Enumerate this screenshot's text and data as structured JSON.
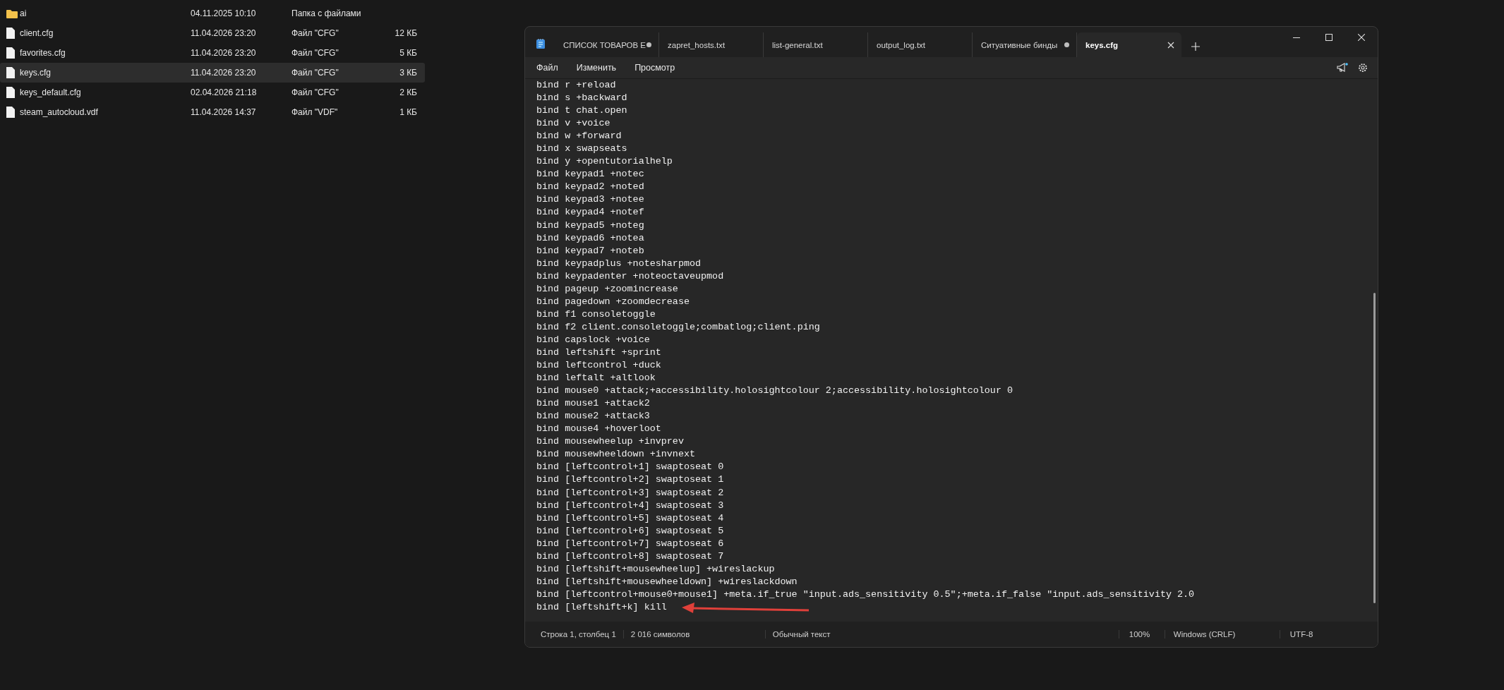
{
  "explorer": {
    "files": [
      {
        "kind": "folder",
        "name": "ai",
        "date": "04.11.2025 10:10",
        "type": "Папка с файлами",
        "selected": false
      },
      {
        "kind": "file",
        "name": "client.cfg",
        "date": "11.04.2026 23:20",
        "type": "Файл \"CFG\"",
        "size": "12 КБ",
        "selected": false
      },
      {
        "kind": "file",
        "name": "favorites.cfg",
        "date": "11.04.2026 23:20",
        "type": "Файл \"CFG\"",
        "size": "5 КБ",
        "selected": false
      },
      {
        "kind": "file",
        "name": "keys.cfg",
        "date": "11.04.2026 23:20",
        "type": "Файл \"CFG\"",
        "size": "3 КБ",
        "selected": true
      },
      {
        "kind": "file",
        "name": "keys_default.cfg",
        "date": "02.04.2026 21:18",
        "type": "Файл \"CFG\"",
        "size": "2 КБ",
        "selected": false
      },
      {
        "kind": "file",
        "name": "steam_autocloud.vdf",
        "date": "11.04.2026 14:37",
        "type": "Файл \"VDF\"",
        "size": "1 КБ",
        "selected": false
      }
    ]
  },
  "notepad": {
    "tabs": [
      {
        "title": "СПИСОК ТОВАРОВ Е",
        "modified": true,
        "selected": false
      },
      {
        "title": "zapret_hosts.txt",
        "modified": false,
        "selected": false
      },
      {
        "title": "list-general.txt",
        "modified": false,
        "selected": false
      },
      {
        "title": "output_log.txt",
        "modified": false,
        "selected": false
      },
      {
        "title": "Ситуативные бинды",
        "modified": true,
        "selected": false
      },
      {
        "title": "keys.cfg",
        "modified": false,
        "selected": true
      }
    ],
    "menu": [
      "Файл",
      "Изменить",
      "Просмотр"
    ],
    "lines": [
      "bind r +reload",
      "bind s +backward",
      "bind t chat.open",
      "bind v +voice",
      "bind w +forward",
      "bind x swapseats",
      "bind y +opentutorialhelp",
      "bind keypad1 +notec",
      "bind keypad2 +noted",
      "bind keypad3 +notee",
      "bind keypad4 +notef",
      "bind keypad5 +noteg",
      "bind keypad6 +notea",
      "bind keypad7 +noteb",
      "bind keypadplus +notesharpmod",
      "bind keypadenter +noteoctaveupmod",
      "bind pageup +zoomincrease",
      "bind pagedown +zoomdecrease",
      "bind f1 consoletoggle",
      "bind f2 client.consoletoggle;combatlog;client.ping",
      "bind capslock +voice",
      "bind leftshift +sprint",
      "bind leftcontrol +duck",
      "bind leftalt +altlook",
      "bind mouse0 +attack;+accessibility.holosightcolour 2;accessibility.holosightcolour 0",
      "bind mouse1 +attack2",
      "bind mouse2 +attack3",
      "bind mouse4 +hoverloot",
      "bind mousewheelup +invprev",
      "bind mousewheeldown +invnext",
      "bind [leftcontrol+1] swaptoseat 0",
      "bind [leftcontrol+2] swaptoseat 1",
      "bind [leftcontrol+3] swaptoseat 2",
      "bind [leftcontrol+4] swaptoseat 3",
      "bind [leftcontrol+5] swaptoseat 4",
      "bind [leftcontrol+6] swaptoseat 5",
      "bind [leftcontrol+7] swaptoseat 6",
      "bind [leftcontrol+8] swaptoseat 7",
      "bind [leftshift+mousewheelup] +wireslackup",
      "bind [leftshift+mousewheeldown] +wireslackdown",
      "bind [leftcontrol+mouse0+mouse1] +meta.if_true \"input.ads_sensitivity 0.5\";+meta.if_false \"input.ads_sensitivity 2.0",
      "bind [leftshift+k] kill"
    ],
    "status_bar": {
      "position": "Строка 1, столбец 1",
      "characters": "2 016 символов",
      "format": "Обычный текст",
      "zoom": "100%",
      "line_endings": "Windows (CRLF)",
      "encoding": "UTF-8"
    }
  }
}
